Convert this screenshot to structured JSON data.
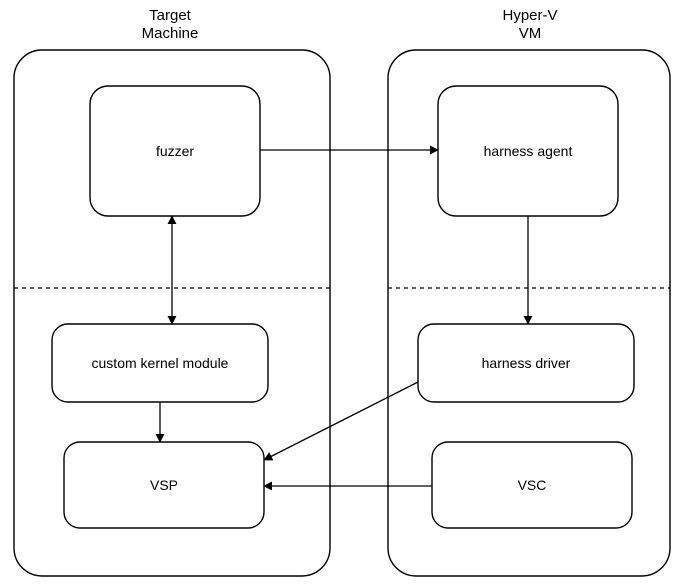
{
  "left": {
    "title_line1": "Target",
    "title_line2": "Machine",
    "nodes": {
      "fuzzer": "fuzzer",
      "kernel_module": "custom kernel module",
      "vsp": "VSP"
    }
  },
  "right": {
    "title_line1": "Hyper-V",
    "title_line2": "VM",
    "nodes": {
      "harness_agent": "harness agent",
      "harness_driver": "harness driver",
      "vsc": "VSC"
    }
  },
  "edges": [
    {
      "from": "fuzzer",
      "to": "harness_agent",
      "bidirectional": false
    },
    {
      "from": "fuzzer",
      "to": "kernel_module",
      "bidirectional": true
    },
    {
      "from": "harness_agent",
      "to": "harness_driver",
      "bidirectional": false
    },
    {
      "from": "kernel_module",
      "to": "vsp",
      "bidirectional": false
    },
    {
      "from": "harness_driver",
      "to": "vsp",
      "bidirectional": false
    },
    {
      "from": "vsc",
      "to": "vsp",
      "bidirectional": false
    }
  ]
}
